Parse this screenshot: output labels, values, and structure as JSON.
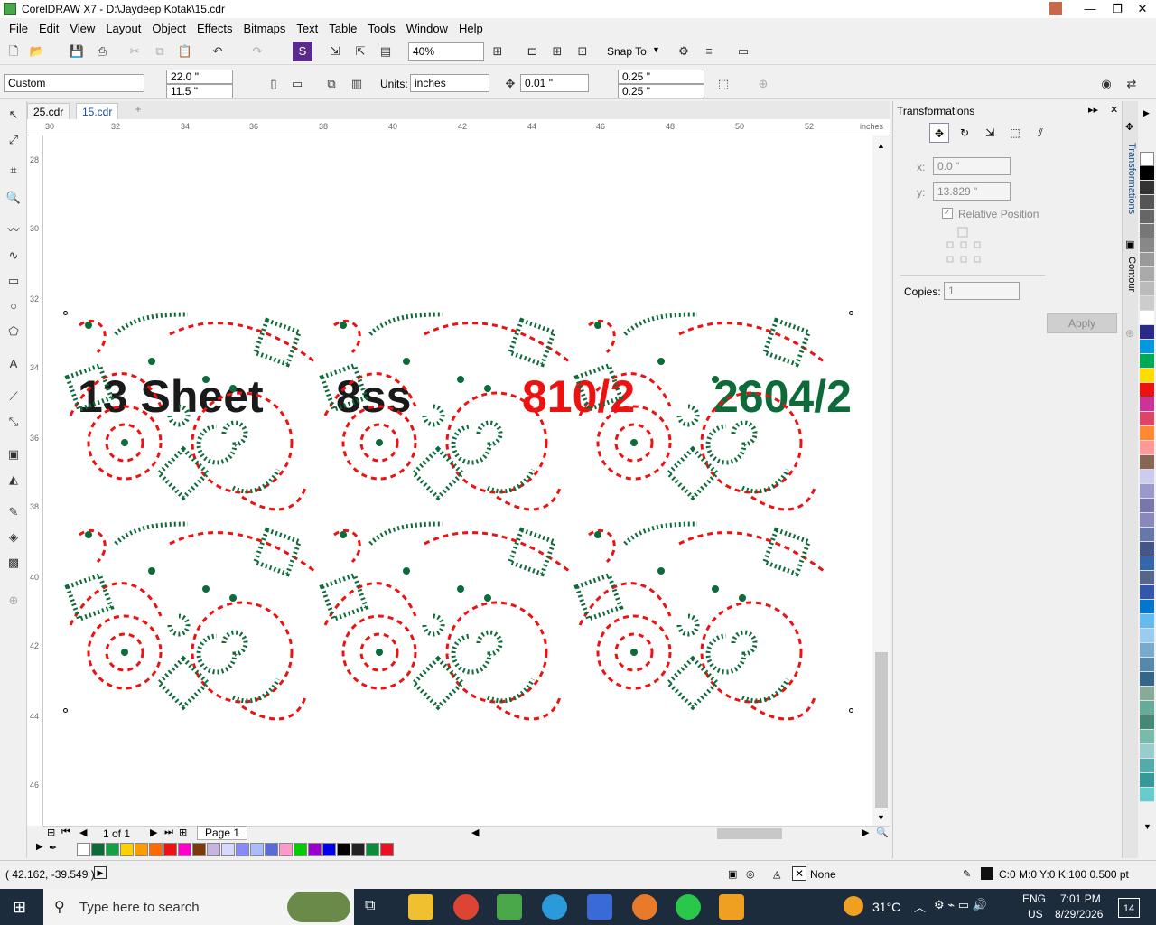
{
  "window": {
    "title": "CorelDRAW X7 - D:\\Jaydeep Kotak\\15.cdr",
    "min": "—",
    "max": "❐",
    "close": "✕"
  },
  "menu": [
    "File",
    "Edit",
    "View",
    "Layout",
    "Object",
    "Effects",
    "Bitmaps",
    "Text",
    "Table",
    "Tools",
    "Window",
    "Help"
  ],
  "toolbar": {
    "zoom": "40%",
    "snap_to": "Snap To"
  },
  "propbar": {
    "paper": "Custom",
    "width": "22.0 \"",
    "height": "11.5 \"",
    "units_label": "Units:",
    "units": "inches",
    "nudge": "0.01 \"",
    "dup_x": "0.25 \"",
    "dup_y": "0.25 \""
  },
  "tabs": [
    "25.cdr",
    "15.cdr"
  ],
  "ruler": {
    "h_labels": [
      "30",
      "32",
      "34",
      "36",
      "38",
      "40",
      "42",
      "44",
      "46",
      "48",
      "50",
      "52"
    ],
    "h_unit": "inches",
    "v_labels": [
      "28",
      "30",
      "32",
      "34",
      "36",
      "38",
      "40",
      "42",
      "44",
      "46"
    ],
    "v_unit": "inches"
  },
  "design": {
    "text1": "13 Sheet",
    "text1_color": "#1a1a1a",
    "text2": "8ss",
    "text2_color": "#1a1a1a",
    "text3": "810/2",
    "text3_color": "#ee1111",
    "text4": "2604/2",
    "text4_color": "#0d6b3a"
  },
  "pagebar": {
    "page_count": "1 of 1",
    "page_tab": "Page 1"
  },
  "docker": {
    "title": "Transformations",
    "x_label": "x:",
    "x_value": "0.0 \"",
    "y_label": "y:",
    "y_value": "13.829 \"",
    "relative_position": "Relative Position",
    "copies_label": "Copies:",
    "copies_value": "1",
    "apply": "Apply",
    "side_tab1": "Transformations",
    "side_tab2": "Contour"
  },
  "status": {
    "coords": "( 42.162, -39.549 )",
    "fill": "None",
    "outline": "C:0 M:0 Y:0 K:100  0.500 pt"
  },
  "taskbar": {
    "search": "Type here to search",
    "temp": "31°C",
    "lang1": "ENG",
    "lang2": "US",
    "time": "7:01 PM",
    "date": "8/29/2026",
    "notif": "14"
  },
  "colors": {
    "red": "#ee1111",
    "green": "#0d6b3a",
    "accent": "#1a4f8a"
  }
}
